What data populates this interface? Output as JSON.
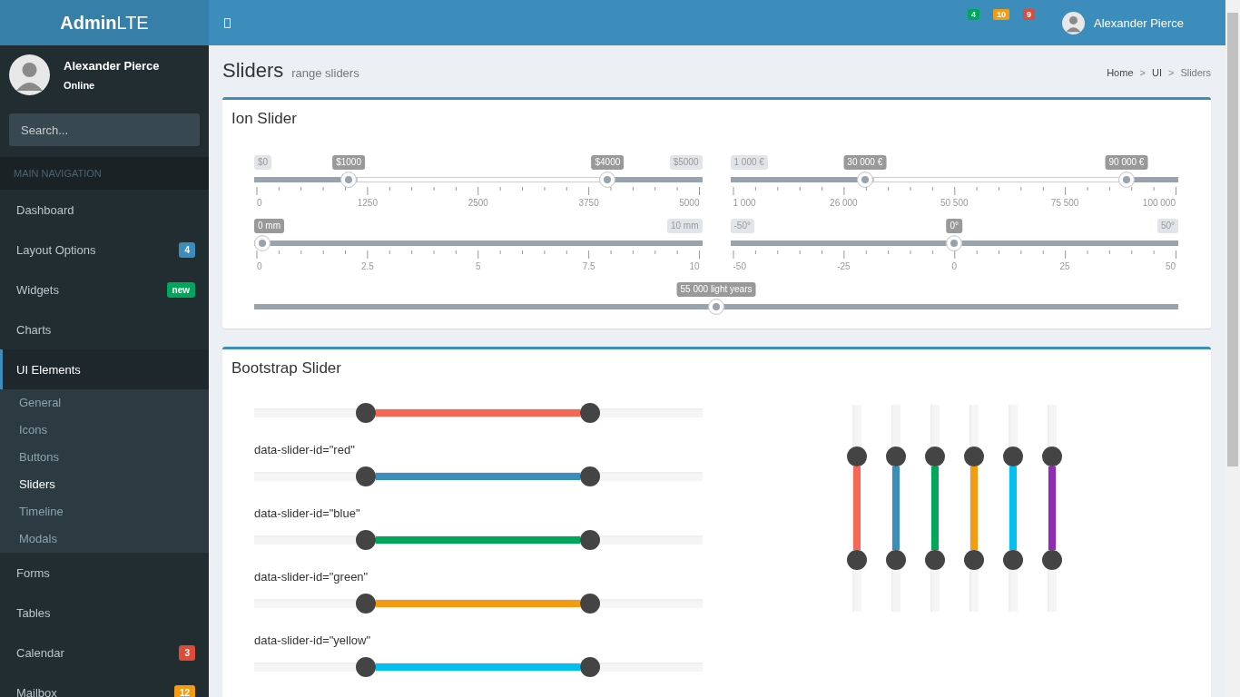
{
  "logo": "**Admin**LTE",
  "navbar": {
    "badges": [
      {
        "count": "4",
        "color": "#00a65a"
      },
      {
        "count": "10",
        "color": "#f39c12"
      },
      {
        "count": "9",
        "color": "#dd4b39"
      }
    ],
    "user_name": "Alexander Pierce"
  },
  "sidebar": {
    "user": {
      "name": "Alexander Pierce",
      "status": "Online"
    },
    "search": {
      "placeholder": "Search..."
    },
    "header": "MAIN NAVIGATION",
    "items": [
      {
        "label": "Dashboard",
        "selected": false
      },
      {
        "label": "Layout Options",
        "selected": false,
        "badge": {
          "text": "4",
          "color": "#3c8dbc"
        }
      },
      {
        "label": "Widgets",
        "selected": false,
        "badge": {
          "text": "new",
          "color": "#00a65a"
        }
      },
      {
        "label": "Charts",
        "selected": false
      },
      {
        "label": "UI Elements",
        "selected": true,
        "expanded": true,
        "children": [
          {
            "label": "General",
            "selected": false
          },
          {
            "label": "Icons",
            "selected": false
          },
          {
            "label": "Buttons",
            "selected": false
          },
          {
            "label": "Sliders",
            "selected": true
          },
          {
            "label": "Timeline",
            "selected": false
          },
          {
            "label": "Modals",
            "selected": false
          }
        ]
      },
      {
        "label": "Forms",
        "selected": false
      },
      {
        "label": "Tables",
        "selected": false
      },
      {
        "label": "Calendar",
        "selected": false,
        "badge": {
          "text": "3",
          "color": "#dd4b39"
        }
      },
      {
        "label": "Mailbox",
        "selected": false,
        "badge": {
          "text": "12",
          "color": "#f39c12"
        }
      }
    ]
  },
  "page_header": {
    "title": "Sliders",
    "subtitle": "range sliders"
  },
  "breadcrumb": [
    {
      "kind": "link",
      "text": "Home"
    },
    {
      "kind": "separator",
      "text": ">"
    },
    {
      "kind": "link",
      "text": "UI"
    },
    {
      "kind": "separator",
      "text": ">"
    },
    {
      "kind": "current",
      "text": "Sliders"
    }
  ],
  "ion_slider": {
    "title": "Ion Slider",
    "rows": [
      [
        {
          "kind": "double",
          "min_label": "$0",
          "max_label": "$5000",
          "handles": [
            {
              "label": "$1000",
              "level": 0.2
            },
            {
              "label": "$4000",
              "level": 0.8
            }
          ],
          "grid": [
            "0",
            "1250",
            "2500",
            "3750",
            "5000"
          ]
        },
        {
          "kind": "double",
          "min_label": "1 000 €",
          "handles": [
            {
              "label": "30 000 €",
              "level": 0.293
            },
            {
              "label": "90 000 €",
              "level": 0.899
            }
          ],
          "grid": [
            "1 000",
            "26 000",
            "50 500",
            "75 500",
            "100 000"
          ]
        }
      ],
      [
        {
          "kind": "single",
          "max_label": "10 mm",
          "handles": [
            {
              "label": "0 mm",
              "level": 0
            }
          ],
          "grid": [
            "0",
            "2.5",
            "5",
            "7.5",
            "10"
          ]
        },
        {
          "kind": "single",
          "min_label": "-50°",
          "max_label": "50°",
          "handles": [
            {
              "label": "0°",
              "level": 0.5
            }
          ],
          "grid": [
            "-50",
            "-25",
            "0",
            "25",
            "50"
          ]
        }
      ],
      [
        {
          "kind": "single",
          "handles": [
            {
              "label": "55 000 light years",
              "level": 0.5
            }
          ]
        }
      ]
    ]
  },
  "bootstrap_slider": {
    "title": "Bootstrap Slider",
    "horizontal": [
      {
        "color": "#f56954",
        "handles": [
          {
            "level": 0.25
          },
          {
            "level": 0.75
          }
        ],
        "caption": "data-slider-id=\"red\""
      },
      {
        "color": "#3c8dbc",
        "handles": [
          {
            "level": 0.25
          },
          {
            "level": 0.75
          }
        ],
        "caption": "data-slider-id=\"blue\""
      },
      {
        "color": "#00a65a",
        "handles": [
          {
            "level": 0.25
          },
          {
            "level": 0.75
          }
        ],
        "caption": "data-slider-id=\"green\""
      },
      {
        "color": "#f39c12",
        "handles": [
          {
            "level": 0.25
          },
          {
            "level": 0.75
          }
        ],
        "caption": "data-slider-id=\"yellow\""
      },
      {
        "color": "#00c0ef",
        "handles": [
          {
            "level": 0.25
          },
          {
            "level": 0.75
          }
        ]
      }
    ],
    "vertical": [
      {
        "color": "#f56954",
        "handles": [
          {
            "level": 0.25
          },
          {
            "level": 0.75
          }
        ]
      },
      {
        "color": "#3c8dbc",
        "handles": [
          {
            "level": 0.25
          },
          {
            "level": 0.75
          }
        ]
      },
      {
        "color": "#00a65a",
        "handles": [
          {
            "level": 0.25
          },
          {
            "level": 0.75
          }
        ]
      },
      {
        "color": "#f39c12",
        "handles": [
          {
            "level": 0.25
          },
          {
            "level": 0.75
          }
        ]
      },
      {
        "color": "#00c0ef",
        "handles": [
          {
            "level": 0.25
          },
          {
            "level": 0.75
          }
        ]
      },
      {
        "color": "#932ab6",
        "handles": [
          {
            "level": 0.25
          },
          {
            "level": 0.75
          }
        ]
      }
    ]
  }
}
